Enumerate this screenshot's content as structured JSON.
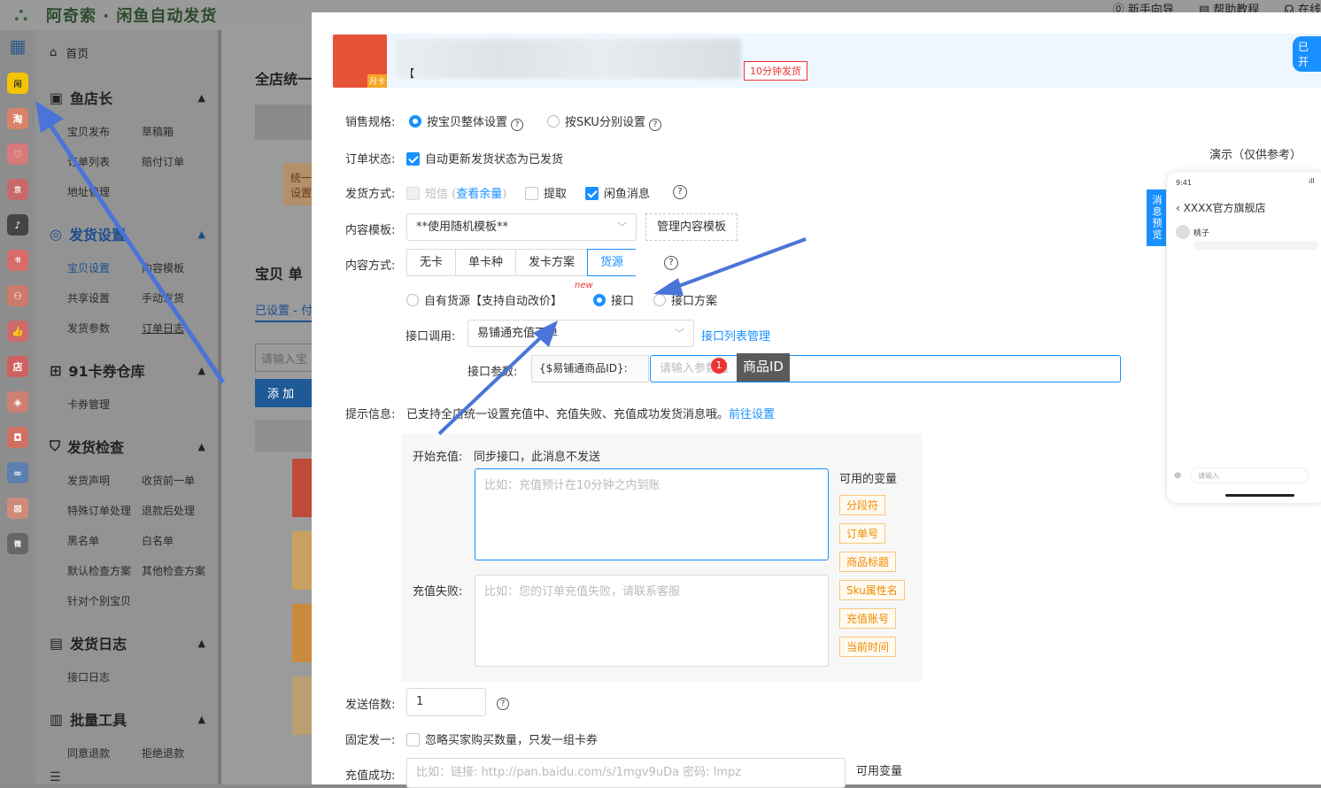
{
  "app": {
    "title": "阿奇索 · 闲鱼自动发货"
  },
  "topbar": {
    "links": [
      "新手向导",
      "帮助教程",
      "在线"
    ]
  },
  "menu": {
    "home": "首页",
    "sections": [
      {
        "title": "鱼店长",
        "items": [
          "宝贝发布",
          "草稿箱",
          "订单列表",
          "赔付订单",
          "地址管理"
        ]
      },
      {
        "title": "发货设置",
        "items": [
          "宝贝设置",
          "内容模板",
          "共享设置",
          "手动发货",
          "发货参数",
          "订单日志"
        ]
      },
      {
        "title": "91卡券仓库",
        "items": [
          "卡券管理"
        ]
      },
      {
        "title": "发货检查",
        "items": [
          "发货声明",
          "收货前一单",
          "特殊订单处理",
          "退款后处理",
          "黑名单",
          "白名单",
          "默认检查方案",
          "其他检查方案",
          "针对个别宝贝"
        ]
      },
      {
        "title": "发货日志",
        "items": [
          "接口日志"
        ]
      },
      {
        "title": "批量工具",
        "items": [
          "同意退款",
          "拒绝退款"
        ]
      }
    ]
  },
  "bgpage": {
    "title": "全店统一",
    "tab": "宝贝 单",
    "filter": "已设置 - 付",
    "search_placeholder": "请输入宝",
    "add_button": "添 加",
    "notice": "统一设置"
  },
  "product": {
    "title_prefix": "【",
    "tag": "10分钟发货",
    "thumb_tag": "月卡",
    "open_badge": "已开"
  },
  "form": {
    "spec_label": "销售规格:",
    "spec_opt1": "按宝贝整体设置",
    "spec_opt2": "按SKU分别设置",
    "order_label": "订单状态:",
    "order_opt": "自动更新发货状态为已发货",
    "ship_label": "发货方式:",
    "ship_sms": "短信",
    "ship_sms_link": "查看余量",
    "ship_pickup": "提取",
    "ship_xianyu": "闲鱼消息",
    "tpl_label": "内容模板:",
    "tpl_value": "**使用随机模板**",
    "tpl_manage": "管理内容模板",
    "mode_label": "内容方式:",
    "modes": [
      "无卡",
      "单卡种",
      "发卡方案",
      "货源"
    ],
    "src_own": "自有货源【支持自动改价】",
    "src_api": "接口",
    "src_api_new": "new",
    "src_plan": "接口方案",
    "api_call_label": "接口调用:",
    "api_call_value": "易铺通充值下单",
    "api_list_link": "接口列表管理",
    "api_param_label": "接口参数:",
    "api_param_name": "{$易铺通商品ID}:",
    "api_param_placeholder": "请输入参数值",
    "tooltip_num": "1",
    "tooltip_text": "商品ID",
    "tip_label": "提示信息:",
    "tip_text": "已支持全店统一设置充值中、充值失败、充值成功发货消息哦。",
    "tip_link": "前往设置",
    "start_label": "开始充值:",
    "start_text": "同步接口，此消息不发送",
    "start_placeholder": "比如：充值预计在10分钟之内到账",
    "fail_label": "充值失败:",
    "fail_placeholder": "比如：您的订单充值失败，请联系客服",
    "vars_title": "可用的变量",
    "vars": [
      "分段符",
      "订单号",
      "商品标题",
      "Sku属性名",
      "充值账号",
      "当前时间"
    ],
    "mult_label": "发送倍数:",
    "mult_value": "1",
    "fixed_label": "固定发一:",
    "fixed_text": "忽略买家购买数量，只发一组卡券",
    "success_label": "充值成功:",
    "success_placeholder": "比如：链接: http://pan.baidu.com/s/1mgv9uDa 密码: lmpz",
    "success_vars": "可用变量"
  },
  "preview": {
    "label": "演示（仅供参考）",
    "tab": "消息预览",
    "time": "9:41",
    "shop": "XXXX官方旗舰店",
    "user": "桃子",
    "input_placeholder": "请输入"
  },
  "colors": {
    "accent": "#1890ff",
    "tag_red": "#ee3333",
    "var_orange": "#f08a00",
    "annotation_arrow": "#4a74d8"
  }
}
